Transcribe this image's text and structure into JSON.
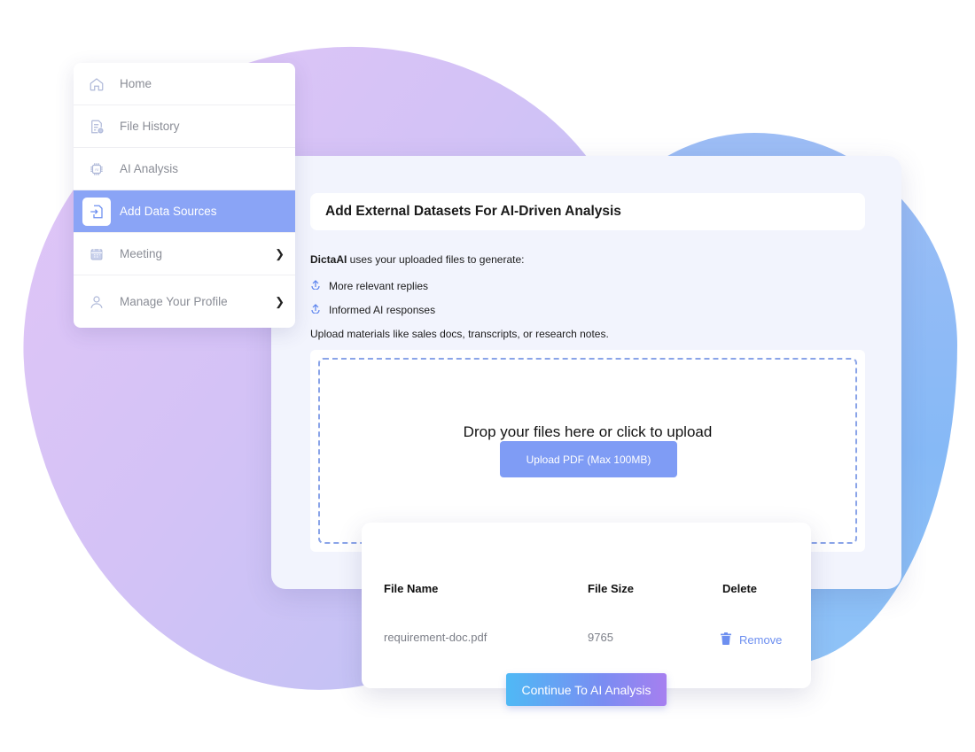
{
  "sidebar": {
    "items": [
      {
        "label": "Home",
        "icon": "home-icon",
        "active": false,
        "chevron": false
      },
      {
        "label": "File History",
        "icon": "file-history-icon",
        "active": false,
        "chevron": false
      },
      {
        "label": "AI Analysis",
        "icon": "ai-chip-icon",
        "active": false,
        "chevron": false
      },
      {
        "label": "Add Data Sources",
        "icon": "file-import-icon",
        "active": true,
        "chevron": false
      },
      {
        "label": "Meeting",
        "icon": "calendar-icon",
        "active": false,
        "chevron": true
      },
      {
        "label": "Manage Your Profile",
        "icon": "user-icon",
        "active": false,
        "chevron": true
      }
    ]
  },
  "panel": {
    "title": "Add External Datasets For AI-Driven Analysis",
    "intro_brand": "DictaAI",
    "intro_text": " uses your uploaded files to generate:",
    "bullets": [
      "More relevant replies",
      "Informed AI responses"
    ],
    "hint": "Upload materials like sales docs, transcripts, or research notes.",
    "drop_text": "Drop your files here or click to upload",
    "upload_button": "Upload PDF (Max 100MB)"
  },
  "files": {
    "headers": {
      "name": "File Name",
      "size": "File Size",
      "delete": "Delete"
    },
    "rows": [
      {
        "name": "requirement-doc.pdf",
        "size": "9765",
        "action": "Remove"
      }
    ]
  },
  "continue_button": "Continue To AI Analysis",
  "colors": {
    "accent": "#7f9cf5",
    "active_nav": "#8aa4f6",
    "link": "#6d8ff0"
  }
}
